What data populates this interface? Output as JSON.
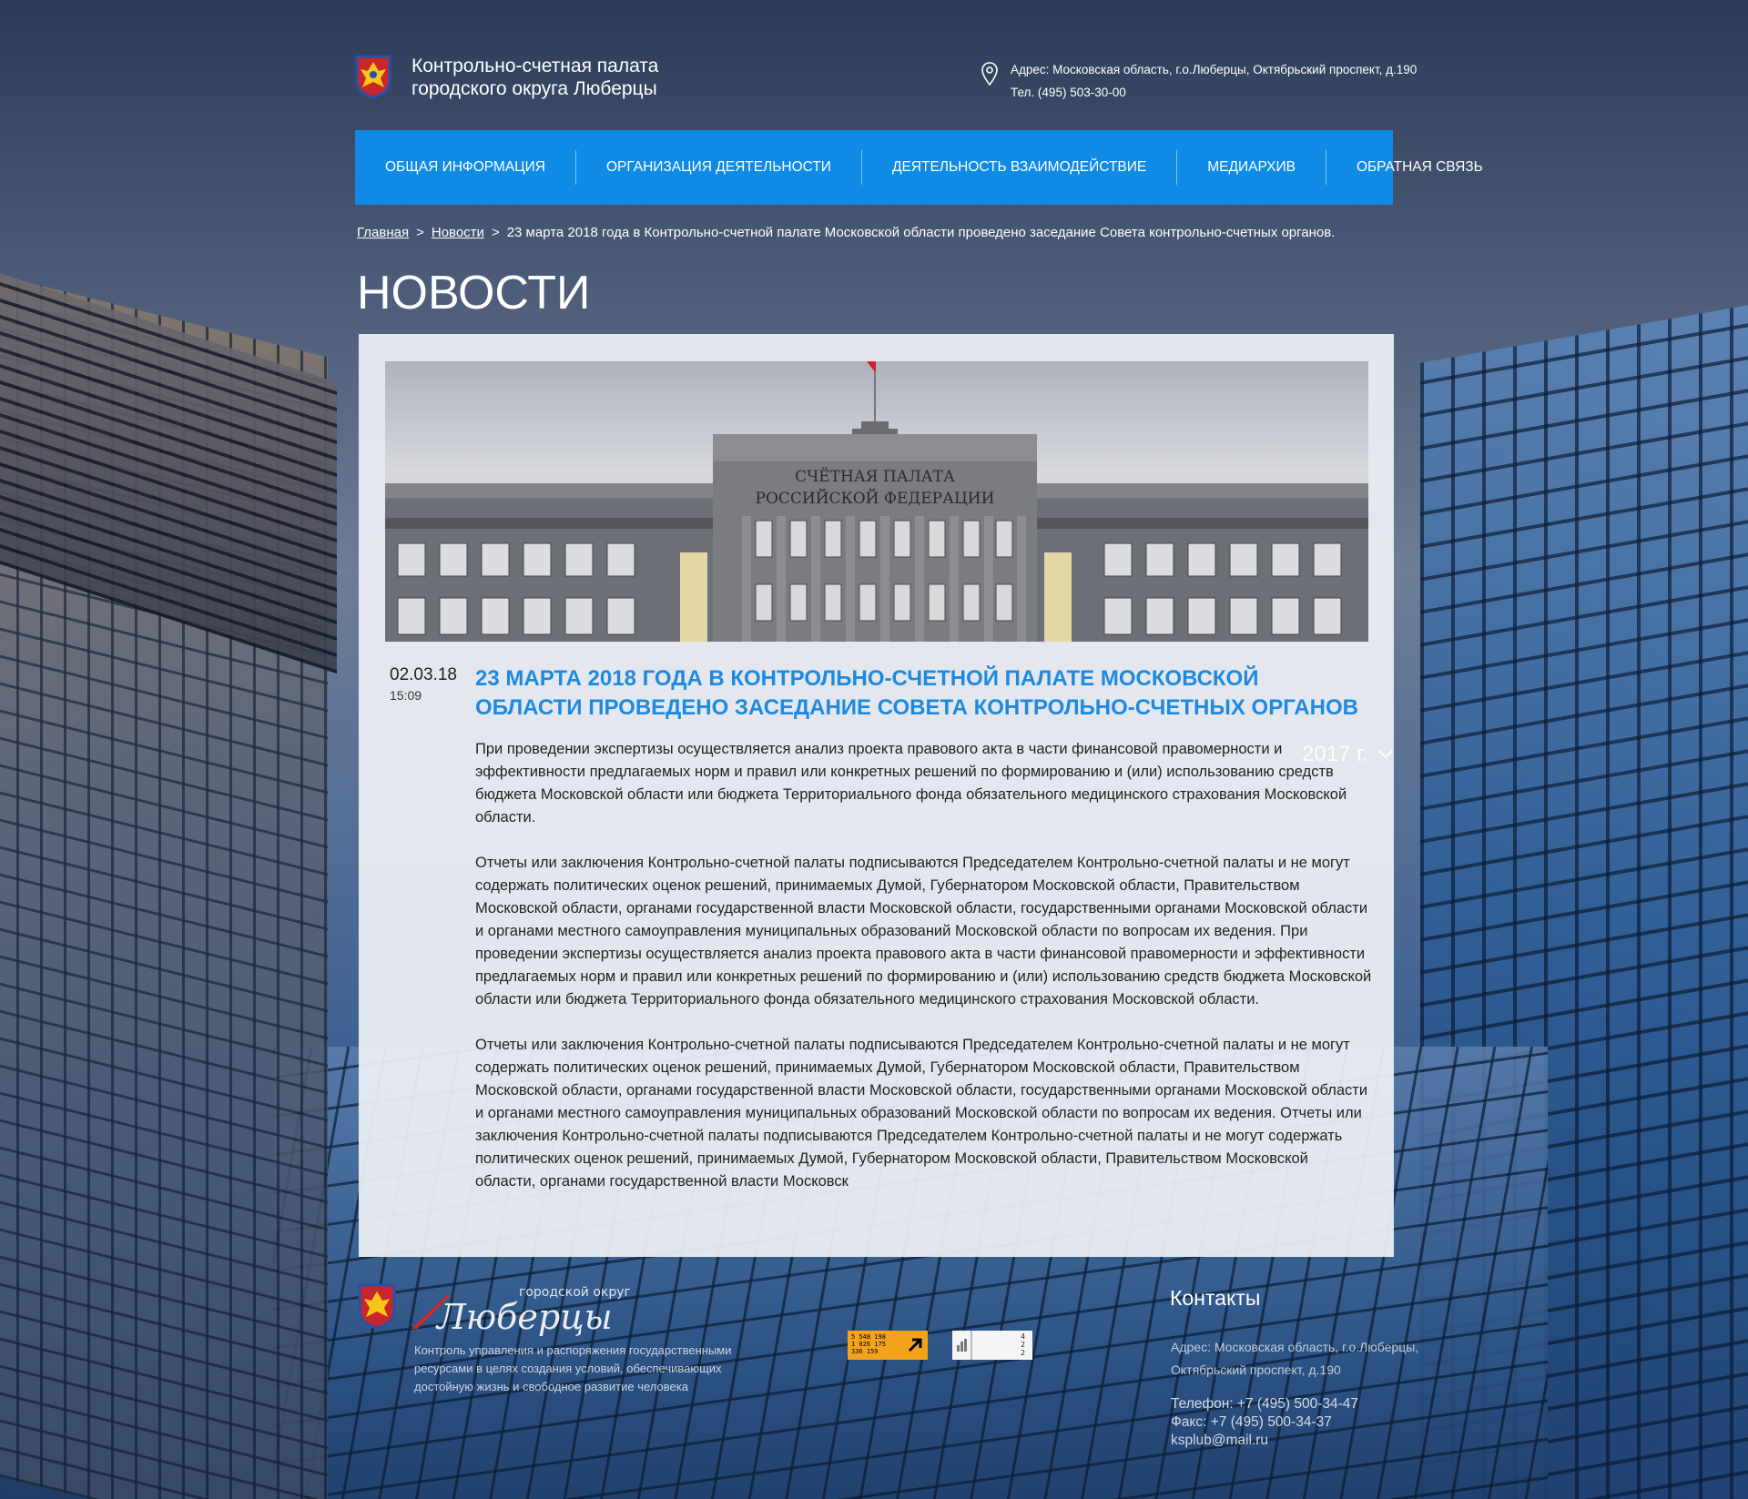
{
  "header": {
    "org_name_line1": "Контрольно-счетная палата",
    "org_name_line2": "городского округа Люберцы",
    "address": "Адрес: Московская область, г.о.Люберцы, Октябрьский проспект, д.190",
    "phone": "Тел. (495) 503-30-00"
  },
  "nav": {
    "items": [
      {
        "label": "ОБЩАЯ ИНФОРМАЦИЯ"
      },
      {
        "label": "ОРГАНИЗАЦИЯ ДЕЯТЕЛЬНОСТИ"
      },
      {
        "label": "ДЕЯТЕЛЬНОСТЬ  ВЗАИМОДЕЙСТВИЕ"
      },
      {
        "label": "МЕДИАРХИВ"
      },
      {
        "label": "ОБРАТНАЯ СВЯЗЬ"
      }
    ]
  },
  "breadcrumb": {
    "home": "Главная",
    "section": "Новости",
    "current": "23 марта 2018 года в Контрольно-счетной палате Московской области проведено заседание Совета контрольно-счетных органов.",
    "separator": ">"
  },
  "page": {
    "title": "НОВОСТИ",
    "year_filter": "2017 г."
  },
  "hero": {
    "sign_line1": "СЧЁТНАЯ ПАЛАТА",
    "sign_line2": "РОССИЙСКОЙ ФЕДЕРАЦИИ"
  },
  "article": {
    "date": "02.03.18",
    "time": "15:09",
    "title": "23 марта 2018 года в Контрольно-счетной палате Московской области проведено заседание Совета контрольно-счетных органов",
    "paragraphs": [
      "При проведении экспертизы осуществляется анализ проекта правового акта в части финансовой правомерности и эффективности предлагаемых норм и правил или конкретных решений по формированию и (или) использованию средств бюджета Московской области или бюджета Территориального фонда обязательного медицинского страхования Московской области.",
      "Отчеты или заключения Контрольно-счетной палаты подписываются Председателем Контрольно-счетной палаты и не могут содержать политических оценок решений, принимаемых Думой, Губернатором Московской области, Правительством Московской области, органами государственной власти Московской области, государственными органами Московской области и органами местного самоуправления муниципальных образований Московской области по вопросам их ведения. При проведении экспертизы осуществляется анализ проекта правового акта в части финансовой правомерности и эффективности предлагаемых норм и правил или конкретных решений по формированию и (или) использованию средств бюджета Московской области или бюджета Территориального фонда обязательного медицинского страхования Московской области.",
      "Отчеты или заключения Контрольно-счетной палаты подписываются Председателем Контрольно-счетной палаты и не могут содержать политических оценок решений, принимаемых Думой, Губернатором Московской области, Правительством Московской области, органами государственной власти Московской области, государственными органами Московской области и органами местного самоуправления муниципальных образований Московской области по вопросам их ведения. Отчеты или заключения Контрольно-счетной палаты подписываются Председателем Контрольно-счетной палаты и не могут содержать политических оценок решений, принимаемых Думой, Губернатором Московской области, Правительством Московской области, органами государственной власти Московск"
    ]
  },
  "footer": {
    "logo_top": "городской округ",
    "logo_main": "Люберцы",
    "tagline": "Контроль управления и распоряжения государственными ресурсами в целях создания условий, обеспечивающих достойную жизнь и свободное развитие человека",
    "counter1_lines": [
      "5 548 198",
      "1 026 175",
      "336 159"
    ],
    "counter2_lines": [
      "4",
      "2",
      "2"
    ],
    "contacts_title": "Контакты",
    "contacts_address_line1": "Адрес: Московская область, г.о.Люберцы,",
    "contacts_address_line2": "Октябрьский проспект, д.190",
    "contacts_phone": "Телефон: +7 (495) 500-34-47",
    "contacts_fax": "Факс: +7 (495) 500-34-37",
    "contacts_email": "ksplub@mail.ru"
  },
  "colors": {
    "nav_bg": "#0f8be6",
    "title_accent": "#1d8ae0",
    "card_bg": "#eef0f4"
  }
}
